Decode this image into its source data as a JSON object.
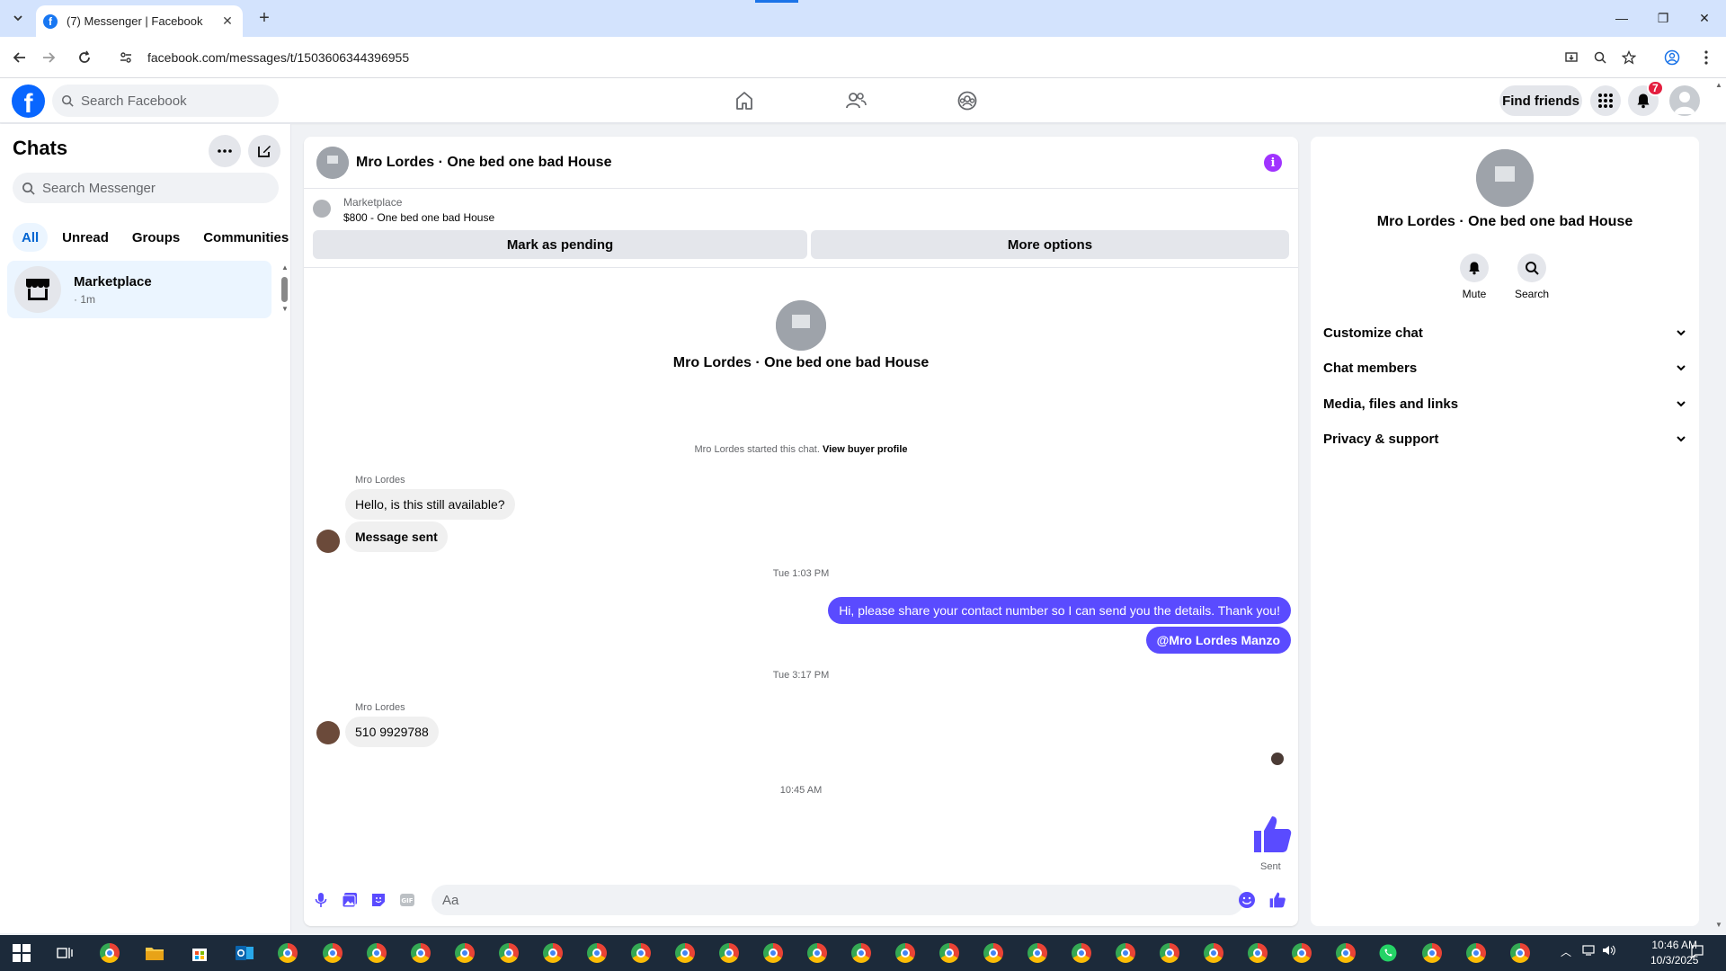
{
  "browser": {
    "tab_title": "(7) Messenger | Facebook",
    "url": "facebook.com/messages/t/1503606344396955"
  },
  "fb": {
    "search_placeholder": "Search Facebook",
    "find_friends": "Find friends",
    "notification_count": "7"
  },
  "chats": {
    "title": "Chats",
    "search_placeholder": "Search Messenger",
    "filters": [
      "All",
      "Unread",
      "Groups",
      "Communities"
    ],
    "active_filter": "All",
    "items": [
      {
        "name": "Marketplace",
        "sub": "· 1m"
      }
    ]
  },
  "conversation": {
    "name": "Mro Lordes · One bed one bad House",
    "marketplace_label": "Marketplace",
    "listing": "$800 - One bed one bad House",
    "mark_pending": "Mark as pending",
    "more_options": "More options",
    "started_text": "Mro Lordes started this chat.",
    "view_profile": "View buyer profile",
    "messages": [
      {
        "sender": "Mro Lordes",
        "text": "Hello, is this still available?"
      },
      {
        "text": "Message sent"
      },
      {
        "timestamp": "Tue 1:03 PM"
      },
      {
        "out": true,
        "text": "Hi, please share your contact number so I can send you the details. Thank you!"
      },
      {
        "out": true,
        "text": "@Mro Lordes Manzo"
      },
      {
        "timestamp": "Tue 3:17 PM"
      },
      {
        "sender": "Mro Lordes",
        "text": "510 9929788"
      },
      {
        "timestamp": "10:45 AM"
      }
    ],
    "sent_label": "Sent",
    "composer_placeholder": "Aa"
  },
  "info_panel": {
    "name": "Mro Lordes · One bed one bad House",
    "actions": [
      "Mute",
      "Search"
    ],
    "sections": [
      "Customize chat",
      "Chat members",
      "Media, files and links",
      "Privacy & support"
    ]
  },
  "taskbar": {
    "time": "10:46 AM",
    "date": "10/3/2025"
  },
  "colors": {
    "fb_blue": "#0866ff",
    "messenger_purple": "#5a4bff",
    "info_purple": "#a033ff",
    "badge_red": "#e41e3f"
  }
}
